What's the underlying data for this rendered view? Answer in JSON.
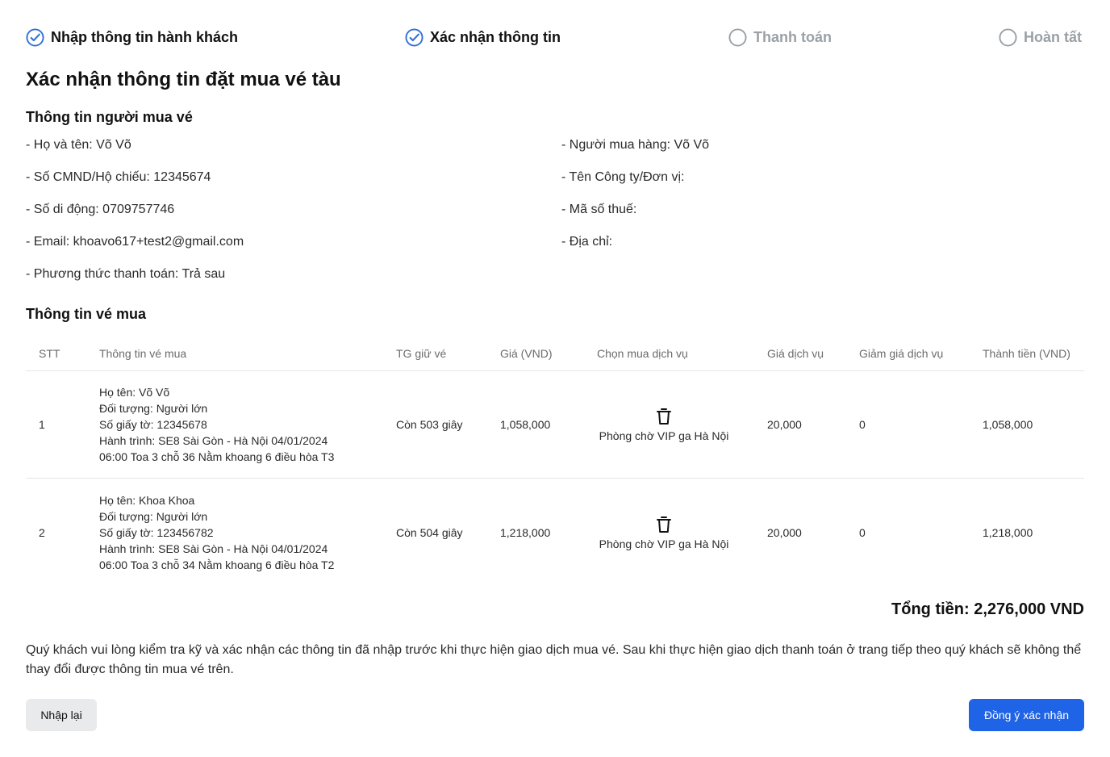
{
  "steps": [
    {
      "label": "Nhập thông tin hành khách",
      "state": "done"
    },
    {
      "label": "Xác nhận thông tin",
      "state": "done"
    },
    {
      "label": "Thanh toán",
      "state": "pending"
    },
    {
      "label": "Hoàn tất",
      "state": "pending"
    }
  ],
  "page_title": "Xác nhận thông tin đặt mua vé tàu",
  "buyer_section": {
    "title": "Thông tin người mua vé",
    "left": [
      "- Họ và tên: Võ Võ",
      "- Số CMND/Hộ chiếu: 12345674",
      "- Số di động: 0709757746",
      "- Email: khoavo617+test2@gmail.com",
      "- Phương thức thanh toán: Trả sau"
    ],
    "right": [
      "- Người mua hàng: Võ Võ",
      "- Tên Công ty/Đơn vị:",
      "- Mã số thuế:",
      "- Địa chỉ:"
    ]
  },
  "ticket_section": {
    "title": "Thông tin vé mua",
    "columns": [
      "STT",
      "Thông tin vé mua",
      "TG giữ vé",
      "Giá (VND)",
      "Chọn mua dịch vụ",
      "Giá dịch vụ",
      "Giảm giá dịch vụ",
      "Thành tiền (VND)"
    ],
    "rows": [
      {
        "stt": "1",
        "info": [
          "Họ tên: Võ Võ",
          "Đối tượng: Người lớn",
          "Số giấy tờ: 12345678",
          "Hành trình: SE8 Sài Gòn - Hà Nội 04/01/2024",
          "06:00 Toa 3 chỗ 36 Nằm khoang 6 điều hòa T3"
        ],
        "hold": "Còn 503 giây",
        "price": "1,058,000",
        "service": "Phòng chờ VIP ga Hà Nội",
        "service_price": "20,000",
        "discount": "0",
        "total": "1,058,000"
      },
      {
        "stt": "2",
        "info": [
          "Họ tên: Khoa Khoa",
          "Đối tượng: Người lớn",
          "Số giấy tờ: 123456782",
          "Hành trình: SE8 Sài Gòn - Hà Nội 04/01/2024",
          "06:00 Toa 3 chỗ 34 Nằm khoang 6 điều hòa T2"
        ],
        "hold": "Còn 504 giây",
        "price": "1,218,000",
        "service": "Phòng chờ VIP ga Hà Nội",
        "service_price": "20,000",
        "discount": "0",
        "total": "1,218,000"
      }
    ]
  },
  "grand_total": "Tổng tiền: 2,276,000 VND",
  "notice": "Quý khách vui lòng kiểm tra kỹ và xác nhận các thông tin đã nhập trước khi thực hiện giao dịch mua vé. Sau khi thực hiện giao dịch thanh toán ở trang tiếp theo quý khách sẽ không thể thay đổi được thông tin mua vé trên.",
  "buttons": {
    "reset": "Nhập lại",
    "confirm": "Đồng ý xác nhận"
  },
  "icons": {
    "done": "check-circle-icon",
    "pending": "empty-circle-icon",
    "remove_service": "trash-icon"
  },
  "colors": {
    "accent": "#1f63e6",
    "done_icon": "#2f6fd6",
    "pending": "#9aa0a6",
    "secondary_button": "#e9eaec"
  }
}
